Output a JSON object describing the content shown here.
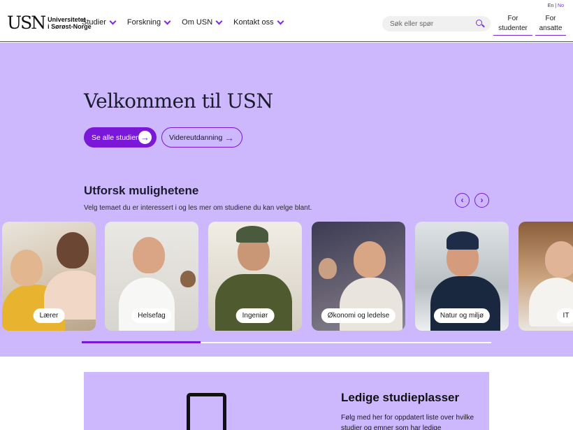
{
  "header": {
    "logo_mark": "USN",
    "logo_line1": "Universitetet",
    "logo_line2": "i Sørøst-Norge",
    "nav": [
      {
        "label": "Studier"
      },
      {
        "label": "Forskning"
      },
      {
        "label": "Om USN"
      },
      {
        "label": "Kontakt oss"
      }
    ],
    "search_placeholder": "Søk eller spør",
    "lang_en": "En",
    "lang_sep": "|",
    "lang_no": "No",
    "for_students_line1": "For",
    "for_students_line2": "studenter",
    "for_staff_line1": "For",
    "for_staff_line2": "ansatte"
  },
  "hero": {
    "title": "Velkommen til USN",
    "primary_button": "Se alle studier",
    "secondary_button": "Videreutdanning",
    "section_title": "Utforsk mulighetene",
    "section_subtitle": "Velg temaet du er interessert i og les mer om studiene du kan velge blant.",
    "cards": [
      {
        "label": "Lærer"
      },
      {
        "label": "Helsefag"
      },
      {
        "label": "Ingeniør"
      },
      {
        "label": "Økonomi og ledelse"
      },
      {
        "label": "Natur og miljø"
      },
      {
        "label": "IT"
      }
    ],
    "carousel_progress_percent": 29
  },
  "panel": {
    "title": "Ledige studieplasser",
    "text": "Følg med her for oppdatert liste over hvilke studier og emner som har ledige"
  },
  "colors": {
    "accent": "#7a17d8",
    "hero_bg": "#cdb8fd"
  },
  "icons": {
    "search": "search-icon",
    "arrow": "arrow-right-icon",
    "prev": "chevron-left-icon",
    "next": "chevron-right-icon"
  }
}
